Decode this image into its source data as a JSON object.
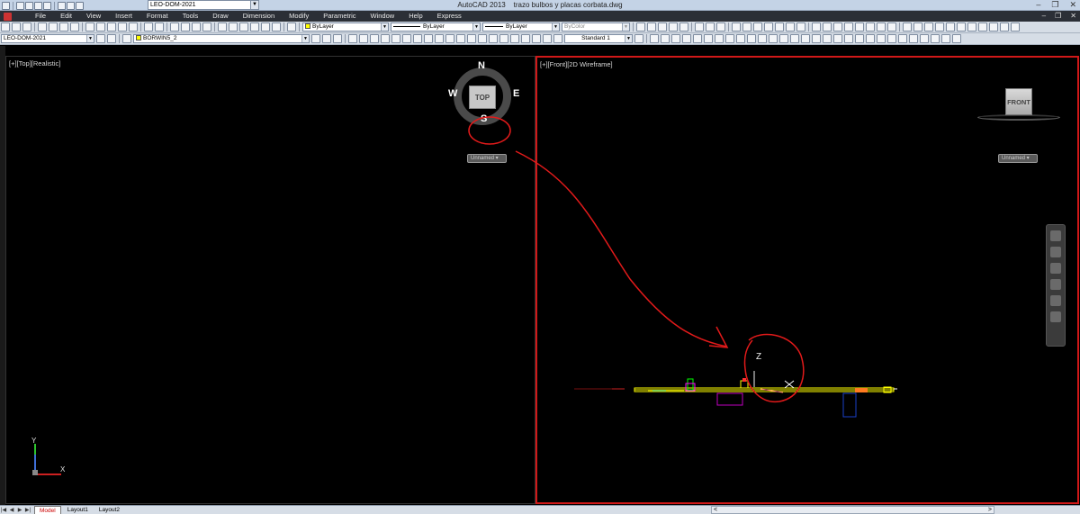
{
  "window": {
    "app_title": "AutoCAD 2013",
    "file_name": "trazo bulbos y placas corbata.dwg",
    "workspace": "LEO-DOM-2021",
    "controls": [
      "–",
      "❐",
      "✕"
    ]
  },
  "menu": {
    "items": [
      "File",
      "Edit",
      "View",
      "Insert",
      "Format",
      "Tools",
      "Draw",
      "Dimension",
      "Modify",
      "Parametric",
      "Window",
      "Help",
      "Express"
    ],
    "right_controls": [
      "–",
      "❐",
      "✕"
    ]
  },
  "toolbar2": {
    "workspace_combo": "LEO-DOM-2021",
    "layer_combo": "BORWIN5_2",
    "color_combo": "ByLayer",
    "linetype_combo": "ByLayer",
    "lineweight_combo": "ByLayer",
    "plotstyle_combo": "ByColor",
    "textstyle_combo": "Standard 1"
  },
  "viewports": {
    "left_label": "[+][Top][Realistic]",
    "right_label": "[+][Front][2D Wireframe]"
  },
  "viewcube": {
    "left_face": "TOP",
    "north": "N",
    "south": "S",
    "east": "E",
    "west": "W",
    "left_ucs": "Unnamed",
    "right_face": "FRONT",
    "right_ucs": "Unnamed"
  },
  "ucs": {
    "left_y": "Y",
    "left_x": "X",
    "right_z": "Z"
  },
  "layout_tabs": {
    "nav_buttons": [
      "|◀",
      "◀",
      "▶",
      "▶|"
    ],
    "tabs": [
      "Model",
      "Layout1",
      "Layout2"
    ],
    "active": "Model",
    "scroll_left": "<",
    "scroll_right": ">"
  },
  "colors": {
    "canvas": "#000000",
    "active_viewport_border": "#d01818",
    "annotation": "#e21a1a",
    "geometry_yellow": "#ffff00"
  }
}
